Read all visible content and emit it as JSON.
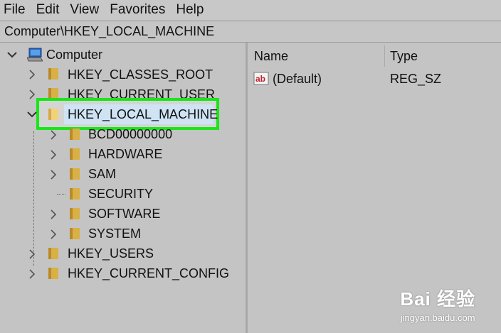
{
  "menu": [
    "File",
    "Edit",
    "View",
    "Favorites",
    "Help"
  ],
  "address": "Computer\\HKEY_LOCAL_MACHINE",
  "tree": {
    "root": "Computer",
    "hives": [
      {
        "label": "HKEY_CLASSES_ROOT"
      },
      {
        "label": "HKEY_CURRENT_USER"
      },
      {
        "label": "HKEY_LOCAL_MACHINE"
      },
      {
        "label": "HKEY_USERS"
      },
      {
        "label": "HKEY_CURRENT_CONFIG"
      }
    ],
    "hklm_children": [
      {
        "label": "BCD00000000"
      },
      {
        "label": "HARDWARE"
      },
      {
        "label": "SAM"
      },
      {
        "label": "SECURITY"
      },
      {
        "label": "SOFTWARE"
      },
      {
        "label": "SYSTEM"
      }
    ]
  },
  "list": {
    "columns": [
      "Name",
      "Type"
    ],
    "rows": [
      {
        "name": "(Default)",
        "type": "REG_SZ",
        "icon": "ab"
      }
    ]
  },
  "watermark": {
    "brand": "Bai  经验",
    "url": "jingyan.baidu.com"
  },
  "colors": {
    "highlight": "#19e619",
    "folder": "#d8b045"
  }
}
